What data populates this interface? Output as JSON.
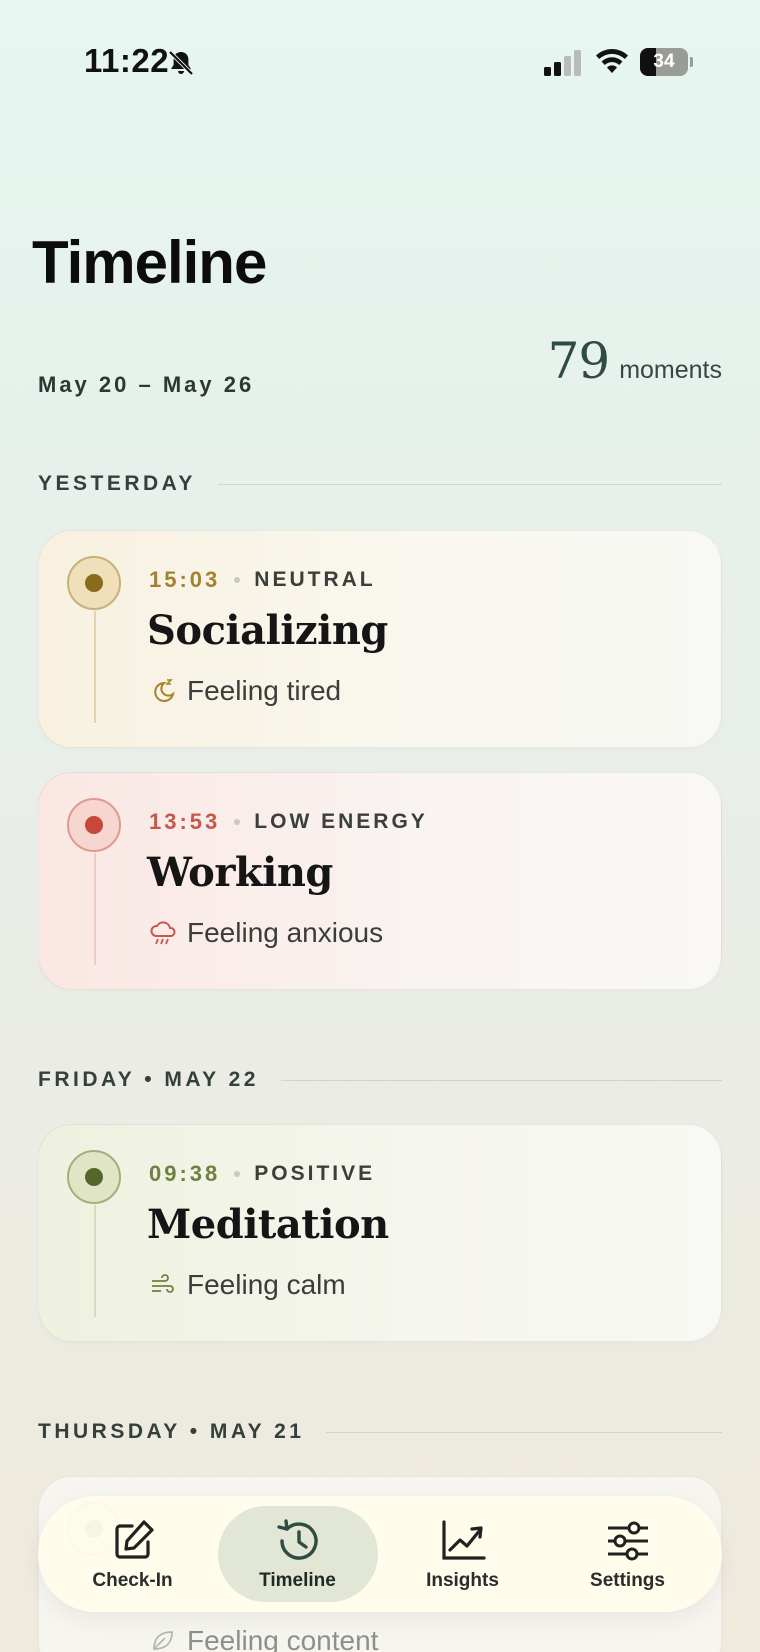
{
  "status_bar": {
    "time": "11:22",
    "battery": "34",
    "battery_level_percent": 34,
    "icons": [
      "bell-slash-icon",
      "cellular-signal-icon",
      "wifi-icon",
      "battery-icon"
    ]
  },
  "header": {
    "title": "Timeline",
    "date_range": "May 20 – May 26",
    "moments_count": "79",
    "moments_label": "moments"
  },
  "sections": [
    {
      "label": "YESTERDAY",
      "entries": [
        {
          "time": "15:03",
          "mood": "NEUTRAL",
          "activity": "Socializing",
          "feeling": "Feeling tired",
          "feeling_icon": "moon-sleep-icon",
          "accent": "#a3822e"
        },
        {
          "time": "13:53",
          "mood": "LOW ENERGY",
          "activity": "Working",
          "feeling": "Feeling anxious",
          "feeling_icon": "rain-cloud-icon",
          "accent": "#c5584a"
        }
      ]
    },
    {
      "label": "FRIDAY • MAY 22",
      "entries": [
        {
          "time": "09:38",
          "mood": "POSITIVE",
          "activity": "Meditation",
          "feeling": "Feeling calm",
          "feeling_icon": "wind-icon",
          "accent": "#6f8040"
        }
      ]
    },
    {
      "label": "THURSDAY • MAY 21",
      "entries": [
        {
          "time": "",
          "mood": "",
          "activity": "",
          "feeling": "Feeling content",
          "feeling_icon": "leaf-icon",
          "accent": "#a8b47c"
        }
      ]
    }
  ],
  "tab_bar": {
    "tabs": [
      {
        "label": "Check-In",
        "icon": "edit-square-icon",
        "active": false
      },
      {
        "label": "Timeline",
        "icon": "history-clock-icon",
        "active": true
      },
      {
        "label": "Insights",
        "icon": "trend-chart-icon",
        "active": false
      },
      {
        "label": "Settings",
        "icon": "sliders-icon",
        "active": false
      }
    ]
  },
  "colors": {
    "neutral": "#a3822e",
    "low_energy": "#c5584a",
    "positive": "#6f8040",
    "moments_count": "#2f4b44"
  }
}
